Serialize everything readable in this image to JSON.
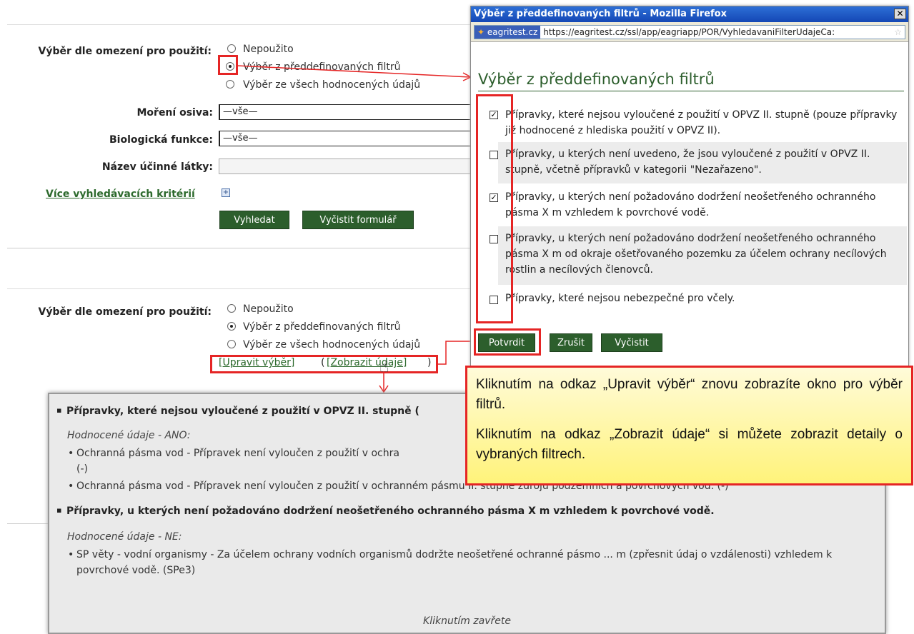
{
  "panel_top": {
    "restriction_label": "Výběr dle omezení pro použití:",
    "options": [
      "Nepoužito",
      "Výběr z předdefinovaných filtrů",
      "Výběr ze všech hodnocených údajů"
    ],
    "selected_option": "Výběr z předdefinovaných filtrů",
    "seed_treatment_label": "Moření osiva:",
    "seed_treatment_value": "—vše—",
    "bio_function_label": "Biologická funkce:",
    "bio_function_value": "—vše—",
    "active_substance_label": "Název účinné látky:",
    "more_criteria_link": "Více vyhledávacích kritérií",
    "search_button": "Vyhledat",
    "clear_form_button": "Vyčistit formulář"
  },
  "panel_bottom": {
    "restriction_label": "Výběr dle omezení pro použití:",
    "options": [
      "Nepoužito",
      "Výběr z předdefinovaných filtrů",
      "Výběr ze všech hodnocených údajů"
    ],
    "selected_option": "Výběr z předdefinovaných filtrů",
    "edit_selection_link": "[Upravit výběr]",
    "show_data_link": "[Zobrazit údaje]"
  },
  "popup": {
    "window_title": "Výběr z předdefinovaných filtrů - Mozilla Firefox",
    "site_badge": "eagritest.cz",
    "url": "https://eagritest.cz/ssl/app/eagriapp/POR/VyhledavaniFilterUdajeCa:",
    "heading": "Výběr z předdefinovaných filtrů",
    "filters": [
      {
        "text": "Přípravky, které nejsou vyloučené z použití v OPVZ II. stupně (pouze přípravky již hodnocené z hlediska použití v OPVZ II).",
        "checked": true
      },
      {
        "text": "Přípravky, u kterých není uvedeno, že jsou vyloučené z použití v OPVZ II. stupně, včetně přípravků v kategorii \"Nezařazeno\".",
        "checked": false
      },
      {
        "text": "Přípravky, u kterých není požadováno dodržení neošetřeného ochranného pásma X m vzhledem k povrchové vodě.",
        "checked": true
      },
      {
        "text": "Přípravky, u kterých není požadováno dodržení neošetřeného ochranného pásma X m od okraje ošetřovaného pozemku za účelem ochrany necílových rostlin a necílových členovců.",
        "checked": false
      },
      {
        "text": "Přípravky, které nejsou nebezpečné pro včely.",
        "checked": false
      }
    ],
    "confirm_button": "Potvrdit",
    "cancel_button": "Zrušit",
    "clear_button": "Vyčistit"
  },
  "callout": {
    "paragraph1": "Kliknutím na odkaz „Upravit výběr“ znovu zobrazíte okno pro výběr filtrů.",
    "paragraph2": "Kliknutím na odkaz „Zobrazit údaje“ si můžete zobrazit detaily o vybraných filtrech."
  },
  "details": {
    "heading1": "Přípravky, které nejsou vyloučené z použití v OPVZ II. stupně (",
    "sub1": "Hodnocené údaje - ANO:",
    "item1a": "Ochranná pásma vod - Přípravek není vyloučen z použití v ochra",
    "item1a_cont": "(-)",
    "item1b": "Ochranná pásma vod - Přípravek není vyloučen z použití v ochranném pásmu II. stupně zdrojů podzemních a povrchových vod. (-)",
    "heading2": "Přípravky, u kterých není požadováno dodržení neošetřeného ochranného pásma X m vzhledem k povrchové vodě.",
    "sub2": "Hodnocené údaje - NE:",
    "item2a": "SP věty - vodní organismy - Za účelem ochrany vodních organismů dodržte neošetřené ochranné pásmo ... m (zpřesnit údaj o vzdálenosti) vzhledem k povrchové vodě. (SPe3)",
    "close_text": "Kliknutím zavřete"
  },
  "colors": {
    "accent_green": "#2c5e2c",
    "highlight_red": "#e52525",
    "titlebar_blue": "#1447b5",
    "callout_yellow": "#fff37a"
  }
}
